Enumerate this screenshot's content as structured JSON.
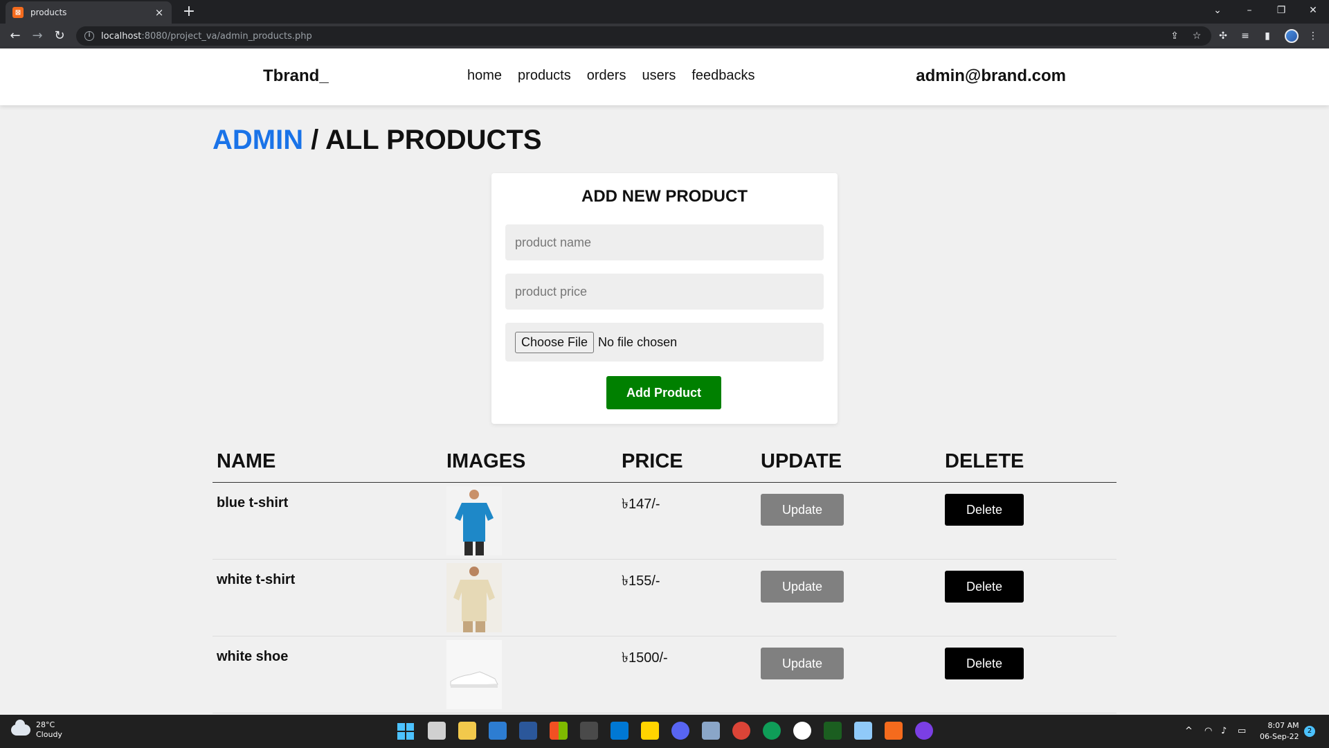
{
  "browser": {
    "tab_title": "products",
    "tab_close": "×",
    "new_tab": "+",
    "url_host": "localhost",
    "url_path": ":8080/project_va/admin_products.php"
  },
  "header": {
    "logo": "Tbrand_",
    "nav": [
      "home",
      "products",
      "orders",
      "users",
      "feedbacks"
    ],
    "admin_email": "admin@brand.com"
  },
  "page": {
    "crumb_admin": "ADMIN",
    "crumb_sep": " / ",
    "crumb_current": "ALL PRODUCTS"
  },
  "form": {
    "title": "ADD NEW PRODUCT",
    "name_placeholder": "product name",
    "price_placeholder": "product price",
    "file_button": "Choose File",
    "file_status": "No file chosen",
    "submit_label": "Add Product"
  },
  "table": {
    "headers": [
      "NAME",
      "IMAGES",
      "PRICE",
      "UPDATE",
      "DELETE"
    ],
    "rows": [
      {
        "name": "blue t-shirt",
        "price": "৳147/-",
        "update": "Update",
        "delete": "Delete",
        "image": "blue-tshirt"
      },
      {
        "name": "white t-shirt",
        "price": "৳155/-",
        "update": "Update",
        "delete": "Delete",
        "image": "white-tshirt"
      },
      {
        "name": "white shoe",
        "price": "৳1500/-",
        "update": "Update",
        "delete": "Delete",
        "image": "white-shoe"
      }
    ]
  },
  "taskbar": {
    "temperature": "28°C",
    "condition": "Cloudy",
    "time": "8:07 AM",
    "date": "06-Sep-22",
    "notifications": "2"
  },
  "colors": {
    "admin_accent": "#1a73e8",
    "add_button": "#008000",
    "update_button": "#808080",
    "delete_button": "#000000"
  }
}
